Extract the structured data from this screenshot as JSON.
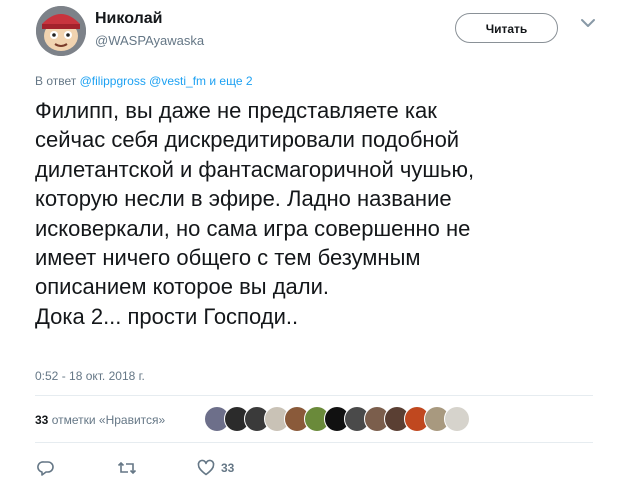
{
  "author": {
    "name": "Николай",
    "handle": "@WASPAyawaska"
  },
  "follow_button": "Читать",
  "reply_context": {
    "prefix": "В ответ",
    "mention1": "@filippgross",
    "mention2": "@vesti_fm",
    "suffix": "и еще 2"
  },
  "tweet": {
    "text": "Филипп, вы даже не представляете как\nсейчас себя дискредитировали подобной\nдилетантской и фантасмагоричной чушью,\nкоторую несли в эфире. Ладно название\nисковеркали, но сама игра совершенно не\nимеет ничего общего с тем безумным\nописанием которое вы дали.\nДока 2... прости Господи..",
    "timestamp": "0:52 - 18 окт. 2018 г."
  },
  "engagement": {
    "likes_count": "33",
    "likes_label": "отметки «Нравится»",
    "likers": [
      "liker-1",
      "liker-2",
      "liker-3",
      "liker-4",
      "liker-5",
      "liker-6",
      "liker-7",
      "liker-8",
      "liker-9",
      "liker-10",
      "liker-11",
      "liker-12",
      "liker-13"
    ]
  },
  "actions": {
    "reply_icon": "reply-icon",
    "retweet_icon": "retweet-icon",
    "like_icon": "heart-icon",
    "like_count": "33"
  },
  "colors": {
    "link": "#1da1f2",
    "muted": "#657786",
    "text": "#14171a",
    "divider": "#e6ecf0"
  }
}
